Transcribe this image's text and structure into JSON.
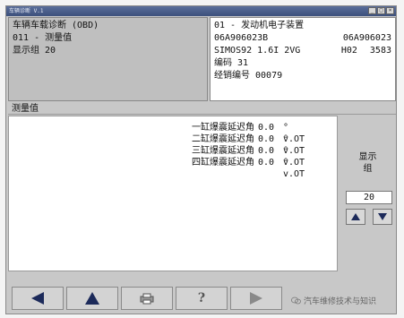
{
  "window": {
    "title": "车辆诊断 V.1"
  },
  "header_left": {
    "line1": "车辆车载诊断 (OBD)",
    "line2": "011 - 测量值",
    "line3": "显示组 20"
  },
  "header_right": {
    "line1": "01 - 发动机电子装置",
    "part_left": "06A906023B",
    "part_right": "06A906023",
    "engine": "SIMOS92 1.6I 2VG",
    "version": "H02",
    "code_tail": "3583",
    "coding": "编码 31",
    "dealer": "经销编号 00079"
  },
  "section": {
    "label": "测量值"
  },
  "measurements": [
    {
      "label": "一缸爆震延迟角",
      "value": "0.0",
      "unit": "° v.OT"
    },
    {
      "label": "二缸爆震延迟角",
      "value": "0.0",
      "unit": "° v.OT"
    },
    {
      "label": "三缸爆震延迟角",
      "value": "0.0",
      "unit": "° v.OT"
    },
    {
      "label": "四缸爆震延迟角",
      "value": "0.0",
      "unit": "° v.OT"
    }
  ],
  "display_group": {
    "label_line1": "显示",
    "label_line2": "组",
    "value": "20"
  },
  "toolbar": {
    "help_label": "?"
  },
  "watermark": {
    "text": "汽车维修技术与知识"
  },
  "icons": {
    "back": "left-arrow-icon",
    "up": "up-arrow-icon",
    "print": "printer-icon",
    "help": "help-icon",
    "forward": "right-arrow-icon"
  }
}
